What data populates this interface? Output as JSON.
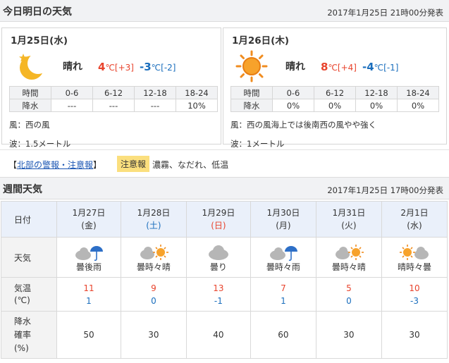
{
  "today": {
    "title": "今日明日の天気",
    "issued": "2017年1月25日 21時00分発表",
    "days": [
      {
        "date": "1月25日(水)",
        "icon": "moon-icon",
        "weather": "晴れ",
        "hi": "4",
        "hi_unit": "℃",
        "hi_diff": "[+3]",
        "lo": "-3",
        "lo_unit": "℃",
        "lo_diff": "[-2]",
        "rain_header": [
          "時間",
          "0-6",
          "6-12",
          "12-18",
          "18-24"
        ],
        "rain_values": [
          "降水",
          "---",
          "---",
          "---",
          "10%"
        ],
        "wind": "風：西の風",
        "wave": "波：1.5メートル"
      },
      {
        "date": "1月26日(木)",
        "icon": "sun-icon",
        "weather": "晴れ",
        "hi": "8",
        "hi_unit": "℃",
        "hi_diff": "[+4]",
        "lo": "-4",
        "lo_unit": "℃",
        "lo_diff": "[-1]",
        "rain_header": [
          "時間",
          "0-6",
          "6-12",
          "12-18",
          "18-24"
        ],
        "rain_values": [
          "降水",
          "0%",
          "0%",
          "0%",
          "0%"
        ],
        "wind": "風：西の風海上では後南西の風やや強く",
        "wave": "波：1メートル"
      }
    ],
    "warning": {
      "bracket_open": "【",
      "link": "北部の警報・注意報",
      "bracket_close": "】",
      "badge": "注意報",
      "items": "濃霧、なだれ、低温"
    }
  },
  "week": {
    "title": "週間天気",
    "issued": "2017年1月25日 17時00分発表",
    "labels": {
      "date": "日付",
      "weather": "天気",
      "temp_1": "気温",
      "temp_2": "(℃)",
      "rain_1": "降水",
      "rain_2": "確率",
      "rain_3": "(%)"
    },
    "days": [
      {
        "date": "1月27日",
        "dow": "(金)",
        "dow_type": "weekday",
        "icon": "cloud-umbrella-icon",
        "weather": "曇後雨",
        "hi": "11",
        "lo": "1",
        "rain": "50"
      },
      {
        "date": "1月28日",
        "dow": "(土)",
        "dow_type": "sat",
        "icon": "cloud-sun-icon",
        "weather": "曇時々晴",
        "hi": "9",
        "lo": "0",
        "rain": "30"
      },
      {
        "date": "1月29日",
        "dow": "(日)",
        "dow_type": "sun",
        "icon": "cloud-icon",
        "weather": "曇り",
        "hi": "13",
        "lo": "-1",
        "rain": "40"
      },
      {
        "date": "1月30日",
        "dow": "(月)",
        "dow_type": "weekday",
        "icon": "cloud-umbrella-icon",
        "weather": "曇時々雨",
        "hi": "7",
        "lo": "1",
        "rain": "60"
      },
      {
        "date": "1月31日",
        "dow": "(火)",
        "dow_type": "weekday",
        "icon": "cloud-sun-icon",
        "weather": "曇時々晴",
        "hi": "5",
        "lo": "0",
        "rain": "30"
      },
      {
        "date": "2月1日",
        "dow": "(水)",
        "dow_type": "weekday",
        "icon": "sun-cloud-icon",
        "weather": "晴時々曇",
        "hi": "10",
        "lo": "-3",
        "rain": "30"
      }
    ]
  }
}
